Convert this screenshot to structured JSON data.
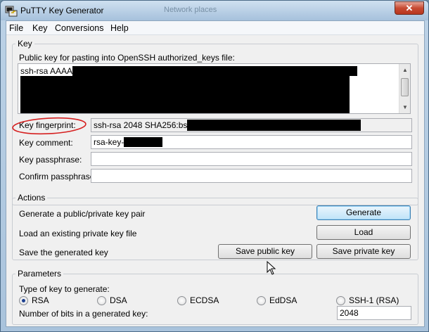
{
  "window": {
    "title": "PuTTY Key Generator",
    "background_title": "Network places",
    "close_glyph": "✕"
  },
  "menu": [
    "File",
    "Key",
    "Conversions",
    "Help"
  ],
  "key_section": {
    "legend": "Key",
    "pubkey_label": "Public key for pasting into OpenSSH authorized_keys file:",
    "pubkey_value": "ssh-rsa AAAA",
    "fingerprint_label": "Key fingerprint:",
    "fingerprint_value": "ssh-rsa 2048 SHA256:bs",
    "comment_label": "Key comment:",
    "comment_value": "rsa-key-",
    "passphrase_label": "Key passphrase:",
    "passphrase_value": "",
    "confirm_label": "Confirm passphrase:",
    "confirm_value": ""
  },
  "actions": {
    "legend": "Actions",
    "generate_text": "Generate a public/private key pair",
    "generate_button": "Generate",
    "load_text": "Load an existing private key file",
    "load_button": "Load",
    "save_text": "Save the generated key",
    "save_public_button": "Save public key",
    "save_private_button": "Save private key"
  },
  "parameters": {
    "legend": "Parameters",
    "type_label": "Type of key to generate:",
    "key_types": [
      {
        "label": "RSA",
        "selected": true
      },
      {
        "label": "DSA",
        "selected": false
      },
      {
        "label": "ECDSA",
        "selected": false
      },
      {
        "label": "EdDSA",
        "selected": false
      },
      {
        "label": "SSH-1 (RSA)",
        "selected": false
      }
    ],
    "bits_label": "Number of bits in a generated key:",
    "bits_value": "2048"
  },
  "colors": {
    "annotation": "#d62020",
    "redaction": "#000000"
  }
}
